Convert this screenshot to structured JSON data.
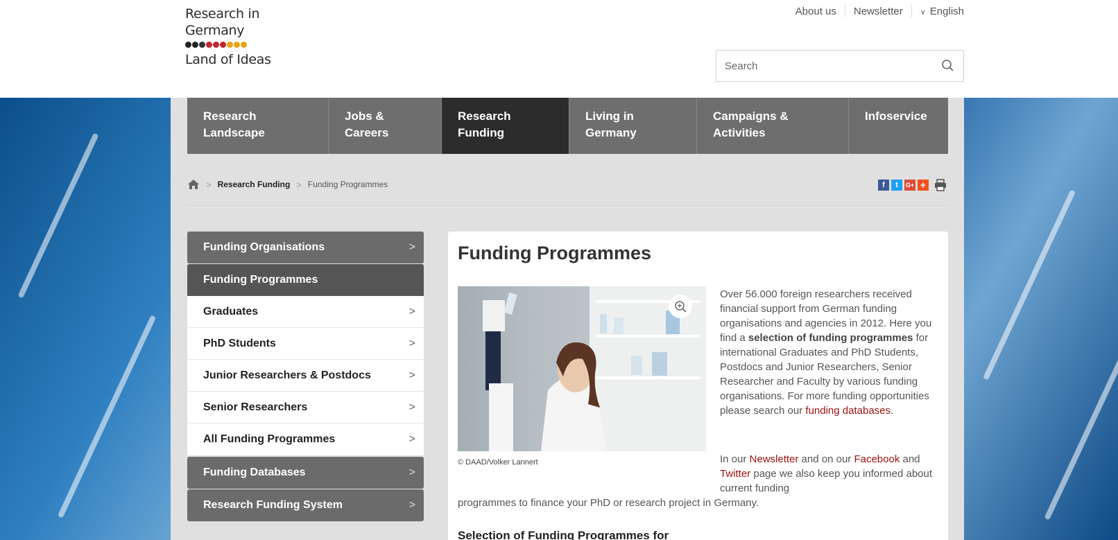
{
  "logo": {
    "line1": "Research in",
    "line2": "Germany",
    "line3": "Land of Ideas",
    "dot_colors": [
      "#222222",
      "#222222",
      "#333333",
      "#c0272d",
      "#c0272d",
      "#c0272d",
      "#e8a317",
      "#e8a317",
      "#e8a317"
    ]
  },
  "topnav": {
    "about": "About us",
    "newsletter": "Newsletter",
    "language": "English"
  },
  "search": {
    "placeholder": "Search"
  },
  "mainnav": [
    {
      "label": "Research\nLandscape"
    },
    {
      "label": "Jobs &\nCareers"
    },
    {
      "label": "Research\nFunding"
    },
    {
      "label": "Living in\nGermany"
    },
    {
      "label": "Campaigns &\nActivities"
    },
    {
      "label": "Infoservice"
    }
  ],
  "breadcrumb": {
    "level1": "Research Funding",
    "current": "Funding Programmes"
  },
  "share": {
    "facebook": "f",
    "twitter": "t",
    "gplus": "G+",
    "plus": "+"
  },
  "sidebar": {
    "items": [
      {
        "label": "Funding Organisations"
      },
      {
        "label": "Funding Programmes"
      },
      {
        "label": "Graduates"
      },
      {
        "label": "PhD Students"
      },
      {
        "label": "Junior Researchers & Postdocs"
      },
      {
        "label": "Senior Researchers"
      },
      {
        "label": "All Funding Programmes"
      },
      {
        "label": "Funding Databases"
      },
      {
        "label": "Research Funding System"
      }
    ]
  },
  "content": {
    "title": "Funding Programmes",
    "caption": "© DAAD/Volker Lannert",
    "p1_a": "Over 56.000 foreign researchers received financial support from German funding organisations and agencies in 2012. Here you find a ",
    "p1_bold": "selection of funding programmes",
    "p1_b": " for international Graduates and PhD Students, Postdocs and Junior Researchers, Senior Researcher and Faculty by various funding organisations. For more funding opportunities please search our ",
    "p1_link": "funding databases",
    "p1_end": ".",
    "p2_a": "In our ",
    "p2_link1": "Newsletter",
    "p2_b": " and on our ",
    "p2_link2": "Facebook",
    "p2_c": " and ",
    "p2_link3": "Twitter",
    "p2_d": " page we also keep you informed about current funding",
    "p3": "programmes to finance your PhD or research project in Germany.",
    "subheading": "Selection of Funding Programmes for"
  }
}
